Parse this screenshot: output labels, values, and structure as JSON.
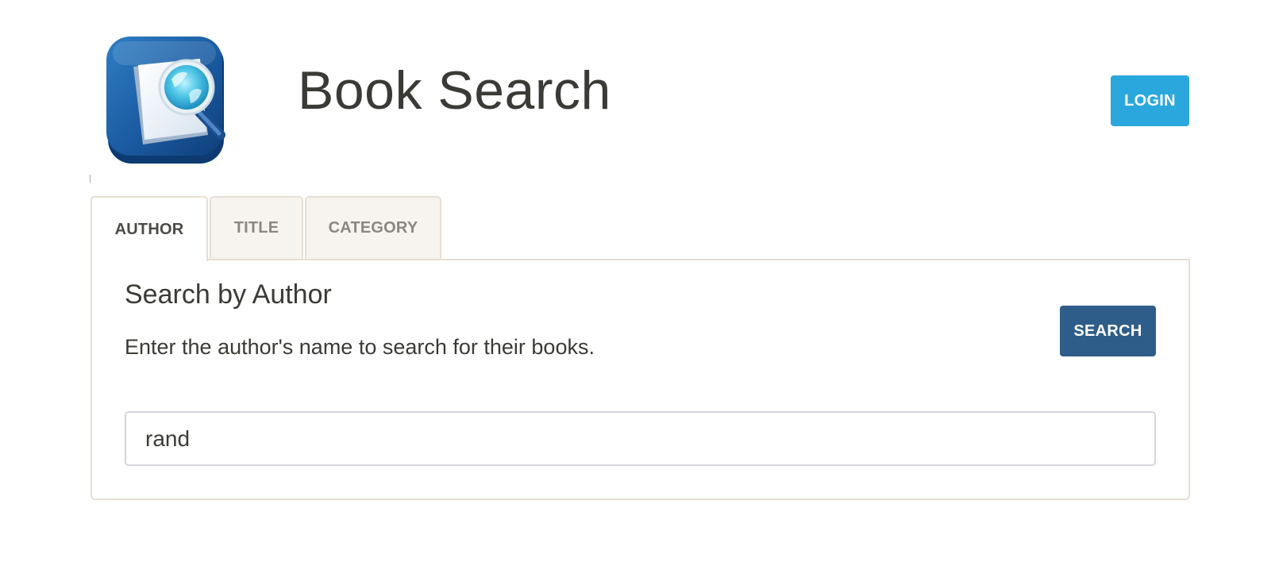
{
  "header": {
    "app_title": "Book Search",
    "logo_icon": "book-magnifier-icon",
    "login_label": "LOGIN"
  },
  "tabs": [
    {
      "label": "AUTHOR",
      "active": true
    },
    {
      "label": "TITLE",
      "active": false
    },
    {
      "label": "CATEGORY",
      "active": false
    }
  ],
  "panel": {
    "heading": "Search by Author",
    "description": "Enter the author's name to search for their books.",
    "search_label": "SEARCH",
    "input_value": "rand",
    "input_placeholder": ""
  },
  "colors": {
    "login_button": "#2aa8dd",
    "search_button": "#2f5d8a",
    "tab_border": "#e7dfd4",
    "text": "#3a3a36"
  }
}
